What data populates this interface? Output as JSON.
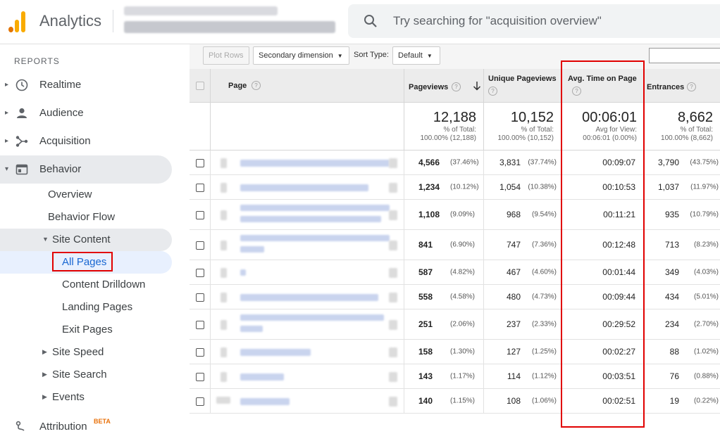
{
  "header": {
    "app_title": "Analytics",
    "search_placeholder": "Try searching for \"acquisition overview\""
  },
  "sidebar": {
    "section_label": "REPORTS",
    "items": [
      {
        "label": "Realtime",
        "icon": "clock-icon"
      },
      {
        "label": "Audience",
        "icon": "person-icon"
      },
      {
        "label": "Acquisition",
        "icon": "acquisition-icon"
      },
      {
        "label": "Behavior",
        "icon": "behavior-icon"
      }
    ],
    "behavior_sub": [
      "Overview",
      "Behavior Flow"
    ],
    "site_content": "Site Content",
    "site_content_sub": [
      "All Pages",
      "Content Drilldown",
      "Landing Pages",
      "Exit Pages"
    ],
    "more": [
      "Site Speed",
      "Site Search",
      "Events"
    ],
    "attribution": "Attribution",
    "beta": "BETA"
  },
  "toolbar": {
    "plot_rows": "Plot Rows",
    "secondary_dimension": "Secondary dimension",
    "sort_type_label": "Sort Type:",
    "sort_type_value": "Default"
  },
  "table": {
    "headers": {
      "page": "Page",
      "pageviews": "Pageviews",
      "unique_pageviews": "Unique Pageviews",
      "avg_time": "Avg. Time on Page",
      "entrances": "Entrances"
    },
    "totals": {
      "pageviews": {
        "value": "12,188",
        "l1": "% of Total:",
        "l2": "100.00% (12,188)"
      },
      "unique": {
        "value": "10,152",
        "l1": "% of Total:",
        "l2": "100.00% (10,152)"
      },
      "avg_time": {
        "value": "00:06:01",
        "l1": "Avg for View:",
        "l2": "00:06:01 (0.00%)"
      },
      "entrances": {
        "value": "8,662",
        "l1": "% of Total:",
        "l2": "100.00% (8,662)"
      }
    },
    "rows": [
      {
        "pv": "4,566",
        "pv_pct": "(37.46%)",
        "up": "3,831",
        "up_pct": "(37.74%)",
        "avg": "00:09:07",
        "ent": "3,790",
        "ent_pct": "(43.75%)"
      },
      {
        "pv": "1,234",
        "pv_pct": "(10.12%)",
        "up": "1,054",
        "up_pct": "(10.38%)",
        "avg": "00:10:53",
        "ent": "1,037",
        "ent_pct": "(11.97%)"
      },
      {
        "pv": "1,108",
        "pv_pct": "(9.09%)",
        "up": "968",
        "up_pct": "(9.54%)",
        "avg": "00:11:21",
        "ent": "935",
        "ent_pct": "(10.79%)"
      },
      {
        "pv": "841",
        "pv_pct": "(6.90%)",
        "up": "747",
        "up_pct": "(7.36%)",
        "avg": "00:12:48",
        "ent": "713",
        "ent_pct": "(8.23%)"
      },
      {
        "pv": "587",
        "pv_pct": "(4.82%)",
        "up": "467",
        "up_pct": "(4.60%)",
        "avg": "00:01:44",
        "ent": "349",
        "ent_pct": "(4.03%)"
      },
      {
        "pv": "558",
        "pv_pct": "(4.58%)",
        "up": "480",
        "up_pct": "(4.73%)",
        "avg": "00:09:44",
        "ent": "434",
        "ent_pct": "(5.01%)"
      },
      {
        "pv": "251",
        "pv_pct": "(2.06%)",
        "up": "237",
        "up_pct": "(2.33%)",
        "avg": "00:29:52",
        "ent": "234",
        "ent_pct": "(2.70%)"
      },
      {
        "pv": "158",
        "pv_pct": "(1.30%)",
        "up": "127",
        "up_pct": "(1.25%)",
        "avg": "00:02:27",
        "ent": "88",
        "ent_pct": "(1.02%)"
      },
      {
        "pv": "143",
        "pv_pct": "(1.17%)",
        "up": "114",
        "up_pct": "(1.12%)",
        "avg": "00:03:51",
        "ent": "76",
        "ent_pct": "(0.88%)"
      },
      {
        "pv": "140",
        "pv_pct": "(1.15%)",
        "up": "108",
        "up_pct": "(1.06%)",
        "avg": "00:02:51",
        "ent": "19",
        "ent_pct": "(0.22%)"
      }
    ]
  },
  "colors": {
    "logo_orange": "#f9ab00",
    "logo_dark_orange": "#e37400",
    "highlight_red": "#e10000",
    "link_blue": "#1a73e8"
  }
}
